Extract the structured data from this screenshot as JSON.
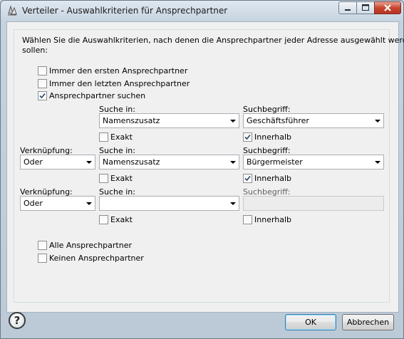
{
  "window": {
    "title": "Verteiler - Auswahlkriterien für Ansprechpartner"
  },
  "intro": {
    "line1": "Wählen Sie die Auswahlkriterien, nach denen die Ansprechpartner jeder Adresse ausgewählt werden",
    "line2": "sollen:"
  },
  "options": {
    "first": {
      "label": "Immer den ersten Ansprechpartner",
      "checked": false
    },
    "last": {
      "label": "Immer den letzten Ansprechpartner",
      "checked": false
    },
    "search": {
      "label": "Ansprechpartner suchen",
      "checked": true
    }
  },
  "criteria": [
    {
      "link_label": "",
      "link_value": "",
      "search_in_label": "Suche in:",
      "search_in_value": "Namenszusatz",
      "term_label": "Suchbegriff:",
      "term_value": "Geschäftsführer",
      "exact_label": "Exakt",
      "exact_checked": false,
      "within_label": "Innerhalb",
      "within_checked": true
    },
    {
      "link_label": "Verknüpfung:",
      "link_value": "Oder",
      "search_in_label": "Suche in:",
      "search_in_value": "Namenszusatz",
      "term_label": "Suchbegriff:",
      "term_value": "Bürgermeister",
      "exact_label": "Exakt",
      "exact_checked": false,
      "within_label": "Innerhalb",
      "within_checked": true
    },
    {
      "link_label": "Verknüpfung:",
      "link_value": "Oder",
      "search_in_label": "Suche in:",
      "search_in_value": "",
      "term_label": "Suchbegriff:",
      "term_value": "",
      "exact_label": "Exakt",
      "exact_checked": false,
      "within_label": "Innerhalb",
      "within_checked": false
    }
  ],
  "bottom_options": {
    "all": {
      "label": "Alle Ansprechpartner",
      "checked": false
    },
    "none": {
      "label": "Keinen Ansprechpartner",
      "checked": false
    }
  },
  "buttons": {
    "ok": "OK",
    "cancel": "Abbrechen",
    "help": "?"
  }
}
